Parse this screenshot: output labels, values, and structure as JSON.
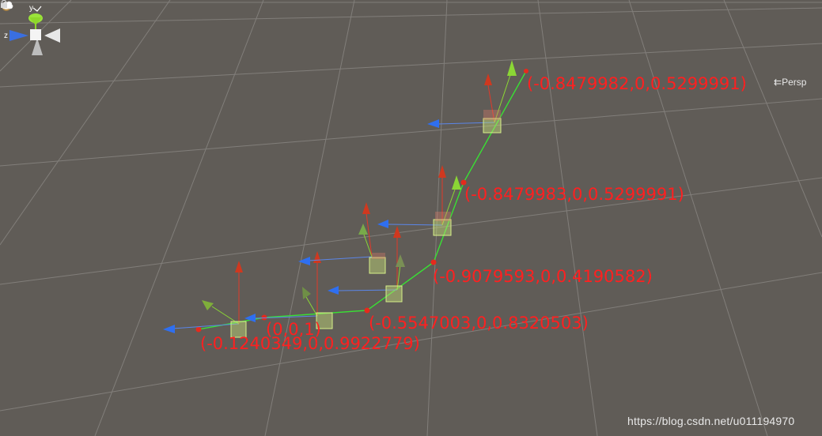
{
  "viewport": {
    "background": "#605c57",
    "grid_color": "#8d8a86",
    "projection_label": "Persp"
  },
  "gizmo": {
    "axis_y": "y",
    "axis_z": "z",
    "colors": {
      "x": "#e8e8e8",
      "y": "#8fd82b",
      "z": "#3a6fe0"
    },
    "icon": "orientation-gizmo-icon"
  },
  "vector_labels": [
    {
      "id": "v1",
      "text": "(-0.8479982,0,0.5299991)"
    },
    {
      "id": "v2",
      "text": "(-0.8479983,0,0.5299991)"
    },
    {
      "id": "v3",
      "text": "(-0.9079593,0,0.4190582)"
    },
    {
      "id": "v4",
      "text": "(-0.5547003,0,0.8320503)"
    },
    {
      "id": "v5",
      "text": "(0,0,1)"
    },
    {
      "id": "v6",
      "text": "(-0.1240349,0,0.9922779)"
    }
  ],
  "colors": {
    "label_red": "#ff2020",
    "path_green": "#39e034",
    "up_red": "#e03a2a",
    "forward_green": "#8bd635",
    "right_blue": "#2f6ff0",
    "box_fill": "#c7e07a"
  },
  "watermark": "https://blog.csdn.net/u011194970"
}
